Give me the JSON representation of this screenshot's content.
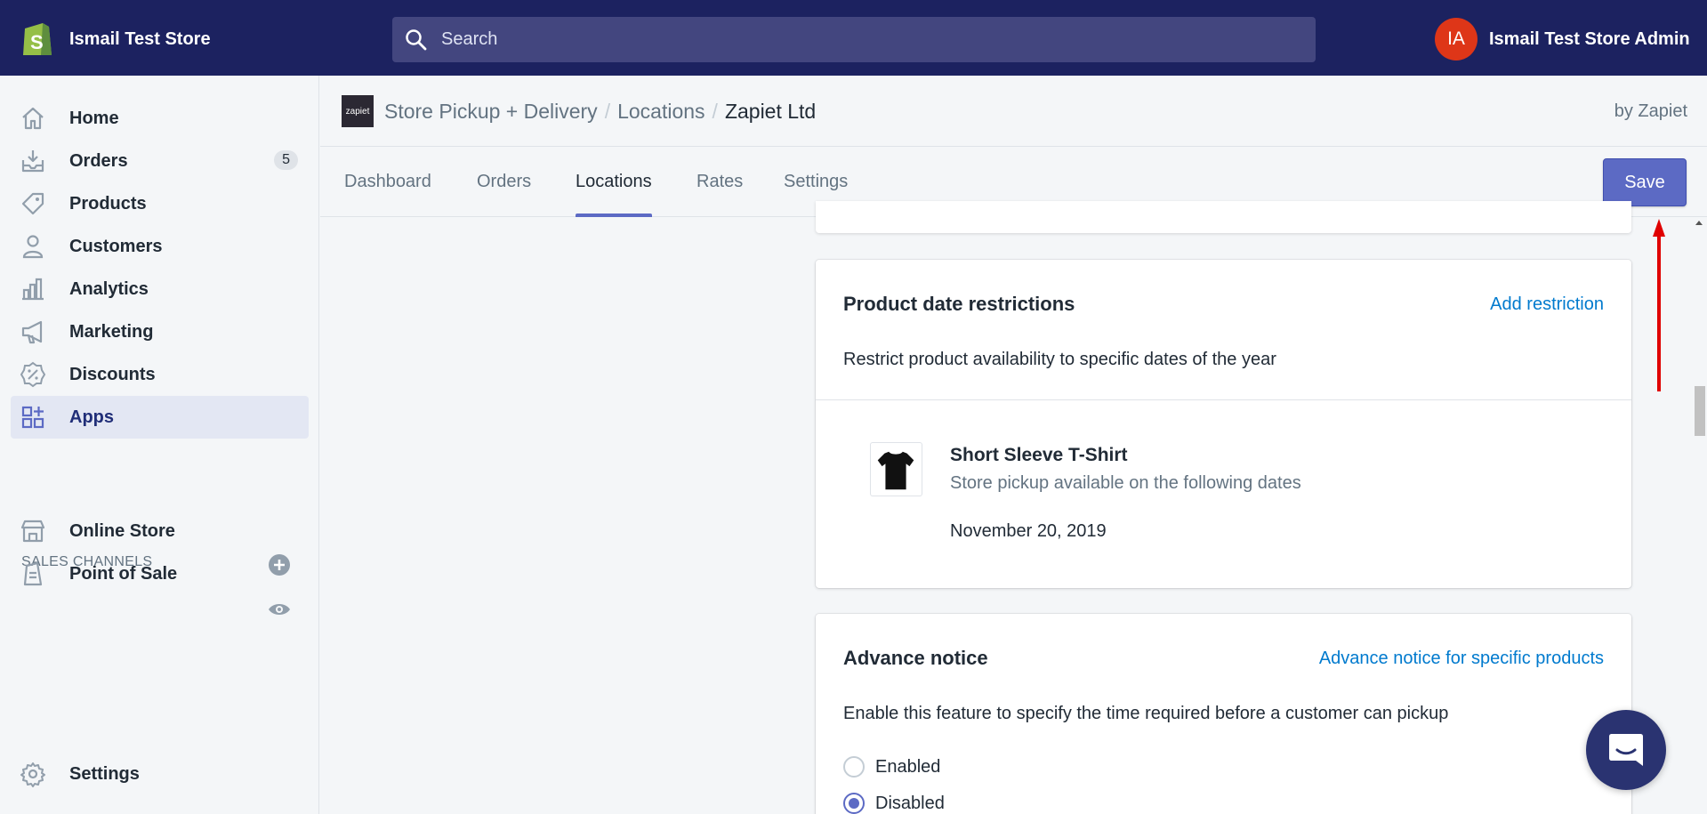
{
  "topbar": {
    "store_name": "Ismail Test Store",
    "search_placeholder": "Search",
    "avatar_initials": "IA",
    "admin_name": "Ismail Test Store Admin"
  },
  "sidebar": {
    "items": [
      {
        "label": "Home",
        "icon": "home-icon"
      },
      {
        "label": "Orders",
        "icon": "orders-icon",
        "badge": "5"
      },
      {
        "label": "Products",
        "icon": "tag-icon"
      },
      {
        "label": "Customers",
        "icon": "person-icon"
      },
      {
        "label": "Analytics",
        "icon": "bar-chart-icon"
      },
      {
        "label": "Marketing",
        "icon": "megaphone-icon"
      },
      {
        "label": "Discounts",
        "icon": "discount-icon"
      },
      {
        "label": "Apps",
        "icon": "apps-icon",
        "active": true
      }
    ],
    "sales_channels_title": "SALES CHANNELS",
    "channels": [
      {
        "label": "Online Store",
        "icon": "store-icon"
      },
      {
        "label": "Point of Sale",
        "icon": "pos-icon"
      }
    ],
    "settings_label": "Settings"
  },
  "appbar": {
    "logo_text": "zapiet",
    "crumb_1": "Store Pickup + Delivery",
    "crumb_2": "Locations",
    "crumb_3": "Zapiet Ltd",
    "sep": "/",
    "byline": "by Zapiet"
  },
  "tabs": {
    "items": [
      "Dashboard",
      "Orders",
      "Locations",
      "Rates",
      "Settings"
    ],
    "active": "Locations",
    "save_label": "Save"
  },
  "product_restrictions": {
    "title": "Product date restrictions",
    "link": "Add restriction",
    "description": "Restrict product availability to specific dates of the year",
    "product_name": "Short Sleeve T-Shirt",
    "product_sub": "Store pickup available on the following dates",
    "product_date": "November 20, 2019"
  },
  "advance_notice": {
    "title": "Advance notice",
    "link": "Advance notice for specific products",
    "description": "Enable this feature to specify the time required before a customer can pickup",
    "options": [
      {
        "label": "Enabled",
        "checked": false
      },
      {
        "label": "Disabled",
        "checked": true
      }
    ]
  },
  "colors": {
    "topbar": "#1c2260",
    "accent": "#5c6ac4",
    "link": "#007ace",
    "annotation": "#e00000"
  }
}
